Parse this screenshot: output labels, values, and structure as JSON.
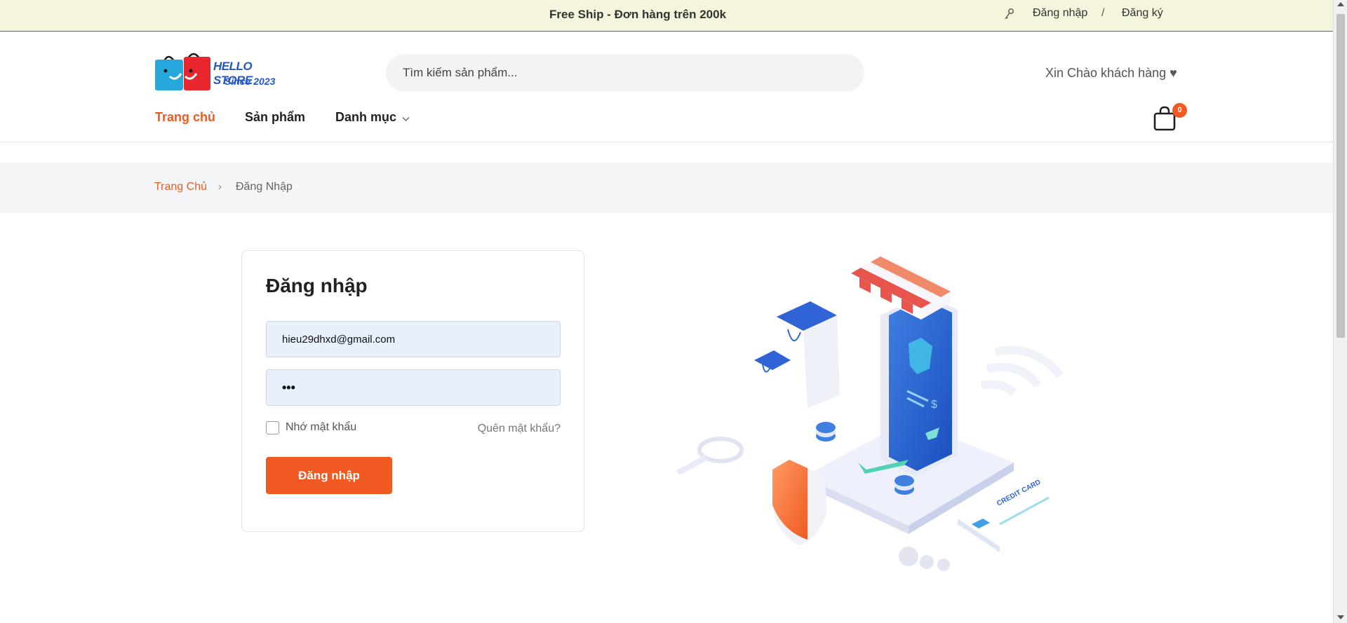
{
  "topbar": {
    "promo": "Free Ship - Đơn hàng trên 200k",
    "login_link": "Đăng nhập",
    "separator": "/",
    "register_link": "Đăng ký"
  },
  "header": {
    "logo": {
      "brand": "HELLO STORE",
      "since": "Since 2023"
    },
    "search_placeholder": "Tìm kiếm sản phẩm...",
    "greeting": "Xin Chào khách hàng ♥",
    "nav": [
      "Trang chủ",
      "Sản phẩm",
      "Danh mục"
    ],
    "cart_count": "0"
  },
  "breadcrumb": {
    "home": "Trang Chủ",
    "separator": "›",
    "current": "Đăng Nhập"
  },
  "login": {
    "title": "Đăng nhập",
    "email_value": "hieu29dhxd@gmail.com",
    "password_value": "•••",
    "remember_label": "Nhớ mật khẩu",
    "remember_checked": false,
    "forgot_link": "Quên mật khẩu?",
    "submit_label": "Đăng nhập"
  },
  "illustration": {
    "card_text": "CREDIT CARD"
  },
  "colors": {
    "accent": "#f05a22",
    "topbar_bg": "#f5f4dc",
    "input_bg": "#e8f0fe"
  }
}
